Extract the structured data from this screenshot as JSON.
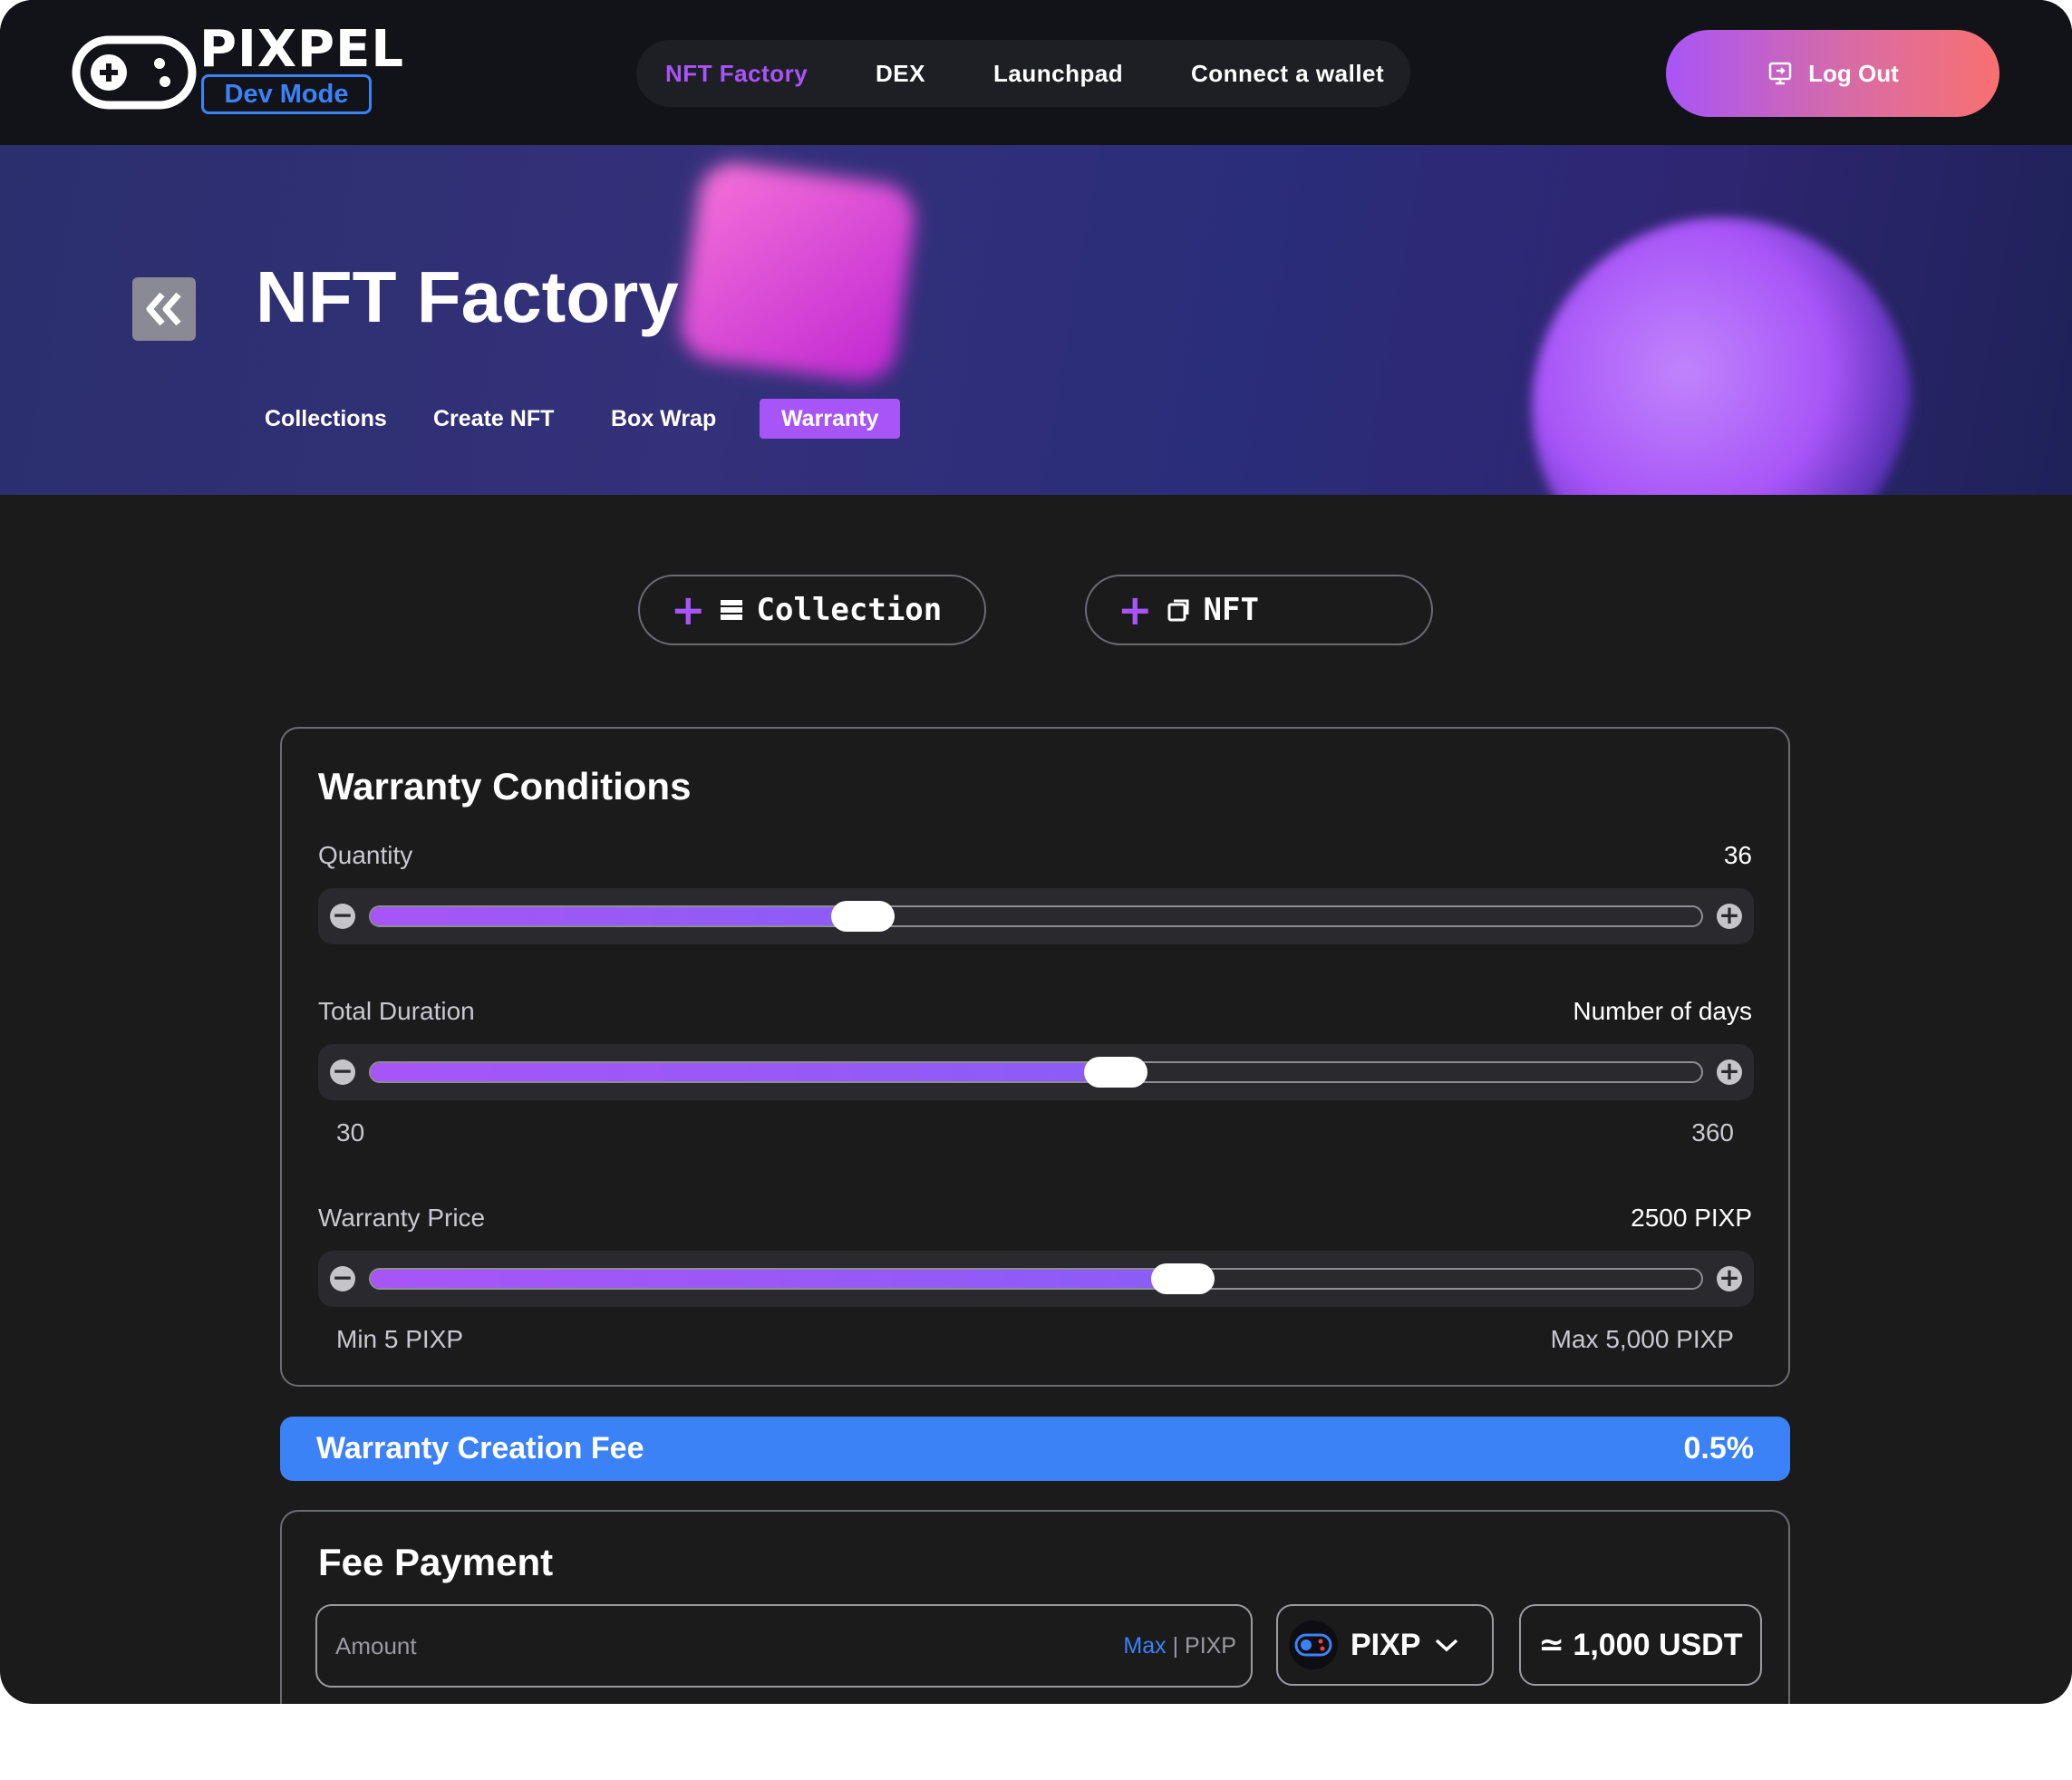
{
  "brand": {
    "name": "PIXPEL",
    "badge": "Dev Mode"
  },
  "nav": {
    "items": [
      "NFT Factory",
      "DEX",
      "Launchpad",
      "Connect a wallet"
    ],
    "active": "NFT Factory"
  },
  "header": {
    "logout_label": "Log Out"
  },
  "hero": {
    "title": "NFT Factory",
    "tabs": [
      "Collections",
      "Create NFT",
      "Box Wrap",
      "Warranty"
    ],
    "active_tab": "Warranty"
  },
  "modes": {
    "collection_label": "Collection",
    "nft_label": "NFT"
  },
  "warranty_conditions": {
    "title": "Warranty Conditions",
    "quantity": {
      "label": "Quantity",
      "value": "36",
      "fill_fraction": 0.37
    },
    "duration": {
      "label": "Total Duration",
      "value": "Number of days",
      "min": "30",
      "max": "360",
      "fill_fraction": 0.56
    },
    "price": {
      "label": "Warranty Price",
      "value": "2500 PIXP",
      "min": "Min 5 PIXP",
      "max": "Max 5,000 PIXP",
      "fill_fraction": 0.61
    }
  },
  "fee": {
    "label": "Warranty Creation Fee",
    "value": "0.5%"
  },
  "fee_payment": {
    "title": "Fee Payment",
    "amount_placeholder": "Amount",
    "max_label": "Max",
    "separator": "|",
    "unit": "PIXP",
    "token": "PIXP",
    "approx_value": "≃ 1,000 USDT"
  },
  "colors": {
    "accent": "#a855f7",
    "blue": "#3b82f6",
    "background": "#1b1b1c"
  }
}
